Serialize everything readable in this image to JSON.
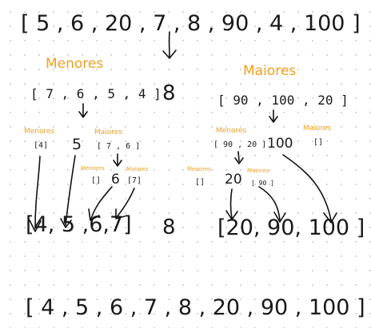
{
  "top_array": "[ 5 , 6 , 20 , 7 , 8 , 90 , 4 , 100 ]",
  "pivot_1": "8",
  "left": {
    "heading": "Menores",
    "array": "[ 7 , 6 , 5 , 4 ]",
    "menores_label": "Menores",
    "menores_array": "[4]",
    "pivot": "5",
    "maiores_label": "Maiores",
    "maiores_array": "[ 7 , 6 ]",
    "sub_menores_label": "Menores",
    "sub_menores_array": "[]",
    "sub_pivot": "6",
    "sub_maiores_label": "Maiores",
    "sub_maiores_array": "[7]",
    "result": "[4, 5 ,6,7]"
  },
  "right": {
    "heading": "Maiores",
    "array": "[ 90 , 100 ,  20 ]",
    "menores_label": "Menores",
    "menores_array": "[ 90 , 20 ]",
    "pivot": "100",
    "maiores_label": "Maiores",
    "maiores_array": "[]",
    "sub_menores_label": "Menores",
    "sub_menores_array": "[]",
    "sub_pivot": "20",
    "sub_maiores_label": "Maiores",
    "sub_maiores_array": "[ 90 ]",
    "result": "[20, 90, 100 ]"
  },
  "pivot_result": "8",
  "final_array": "[ 4 , 5 , 6 , 7 , 8 , 20 , 90 , 100 ]",
  "colors": {
    "label": "#f0a020",
    "ink": "#1a1a1a"
  }
}
